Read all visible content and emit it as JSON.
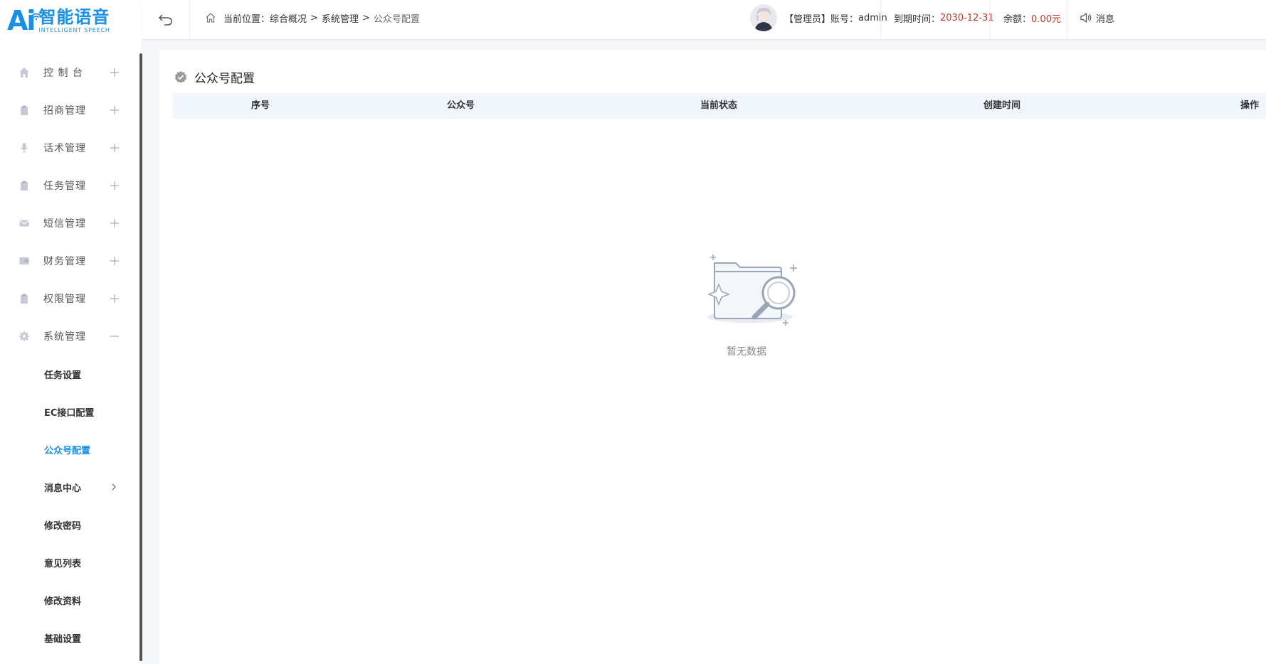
{
  "logo": {
    "mark": "Ai",
    "name_cn": "智能语音",
    "name_en": "INTELLIGENT SPEECH"
  },
  "sidebar": {
    "menus": [
      {
        "label": "控 制 台",
        "icon": "home-icon",
        "expanded": false
      },
      {
        "label": "招商管理",
        "icon": "clipboard-icon",
        "expanded": false
      },
      {
        "label": "话术管理",
        "icon": "microphone-icon",
        "expanded": false
      },
      {
        "label": "任务管理",
        "icon": "clipboard-icon",
        "expanded": false
      },
      {
        "label": "短信管理",
        "icon": "envelope-icon",
        "expanded": false
      },
      {
        "label": "财务管理",
        "icon": "wallet-icon",
        "expanded": false
      },
      {
        "label": "权限管理",
        "icon": "clipboard-icon",
        "expanded": false
      },
      {
        "label": "系统管理",
        "icon": "gear-icon",
        "expanded": true
      }
    ],
    "submenu": [
      {
        "label": "任务设置",
        "active": false
      },
      {
        "label": "EC接口配置",
        "active": false
      },
      {
        "label": "公众号配置",
        "active": true
      },
      {
        "label": "消息中心",
        "active": false,
        "has_children": true
      },
      {
        "label": "修改密码",
        "active": false
      },
      {
        "label": "意见列表",
        "active": false
      },
      {
        "label": "修改资料",
        "active": false
      },
      {
        "label": "基础设置",
        "active": false
      }
    ]
  },
  "topbar": {
    "breadcrumb": {
      "prefix": "当前位置：",
      "items": [
        "综合概况",
        "系统管理"
      ],
      "separator": ">",
      "current": "公众号配置"
    },
    "user": {
      "role_label": "【管理员】账号：",
      "account": "admin"
    },
    "expiry": {
      "label": "到期时间：",
      "value": "2030-12-31"
    },
    "balance": {
      "label": "余额：",
      "value": "0.00元"
    },
    "message": {
      "label": "消息"
    }
  },
  "main": {
    "title": "公众号配置",
    "table": {
      "columns": [
        "序号",
        "公众号",
        "当前状态",
        "创建时间",
        "操作"
      ],
      "rows": []
    },
    "empty_text": "暂无数据"
  },
  "colors": {
    "accent": "#1a8fe3",
    "danger": "#c0392b",
    "table_header_bg": "#f0f6fb"
  }
}
